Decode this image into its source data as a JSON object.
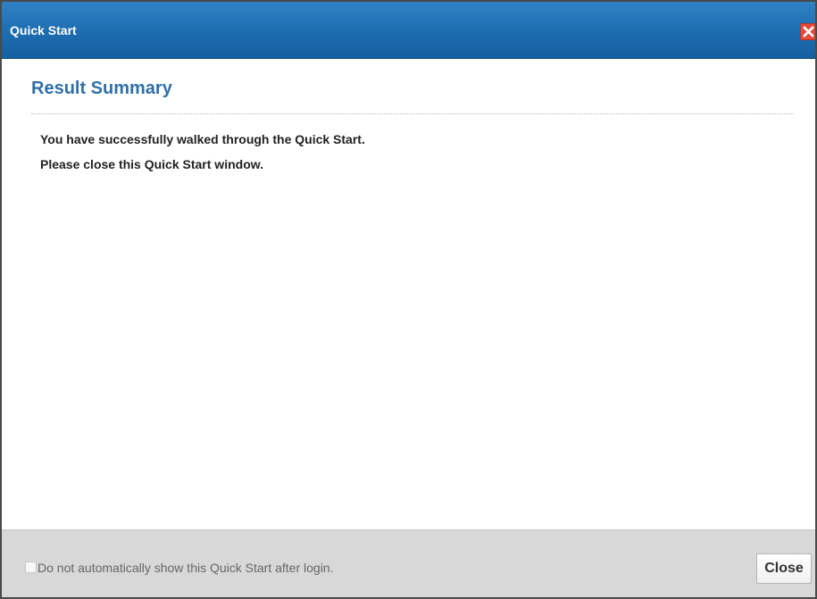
{
  "window": {
    "title": "Quick Start",
    "close_icon": "close-icon"
  },
  "content": {
    "section_title": "Result Summary",
    "messages": [
      "You have successfully walked through the Quick Start.",
      "Please close this Quick Start window."
    ]
  },
  "footer": {
    "checkbox": {
      "label": "Do not automatically show this Quick Start after login.",
      "checked": false
    },
    "close_button_label": "Close"
  },
  "colors": {
    "titlebar": "#1f6fb3",
    "title_text": "#ffffff",
    "section_title": "#2f70a8",
    "close_icon_bg": "#e64a3a",
    "footer_bg": "#d8d8d8"
  }
}
